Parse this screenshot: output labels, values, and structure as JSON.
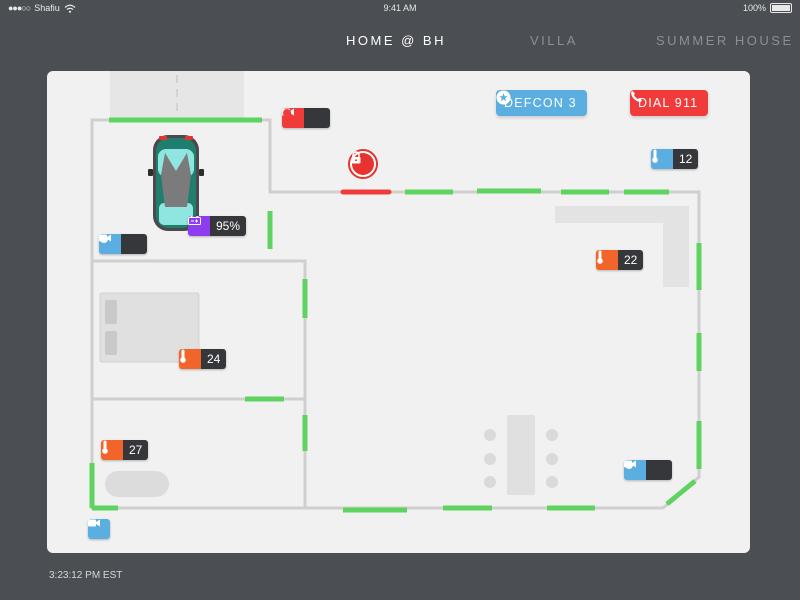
{
  "status_bar": {
    "carrier": "Shafiu",
    "time": "9:41 AM",
    "battery": "100%"
  },
  "tabs": [
    {
      "label": "HOME @ BH",
      "active": true
    },
    {
      "label": "VILLA",
      "active": false
    },
    {
      "label": "SUMMER HOUSE",
      "active": false
    }
  ],
  "actions": {
    "defcon": {
      "label": "DEFCON 3",
      "icon": "star-icon",
      "color": "#5aaee0"
    },
    "dial": {
      "label": "DIAL 911",
      "icon": "phone-icon",
      "color": "#f13a3a"
    }
  },
  "car": {
    "battery_label": "95%",
    "battery_level": 0.95
  },
  "sensors": {
    "outdoor_temp": "12",
    "kitchen_temp": "22",
    "bedroom_temp": "24",
    "bath_temp": "27"
  },
  "colors": {
    "camera": "#5aaee0",
    "alarm": "#f13a3a",
    "temp": "#f2652a",
    "battery": "#8e3cf0",
    "open": "#5fd35f"
  },
  "footer": {
    "timestamp": "3:23:12 PM EST"
  }
}
